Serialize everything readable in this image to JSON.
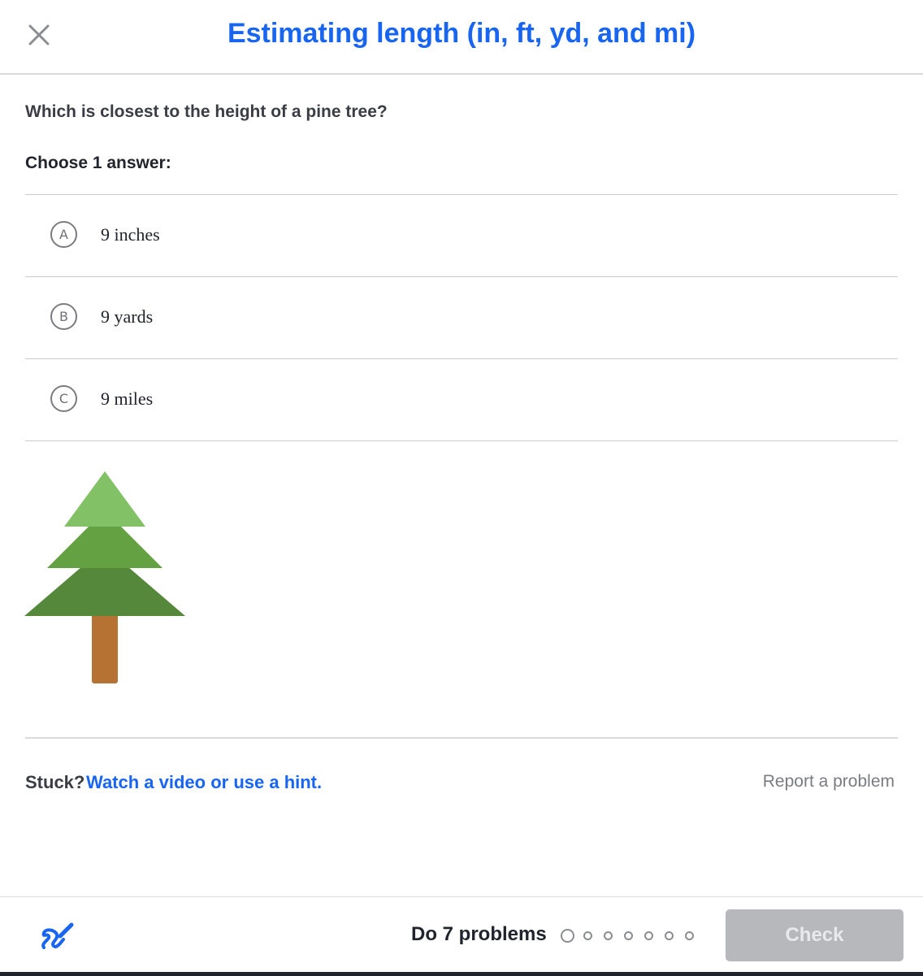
{
  "header": {
    "title": "Estimating length (in, ft, yd, and mi)",
    "close_icon": "close-icon"
  },
  "question": {
    "prompt": "Which is closest to the height of a pine tree?",
    "instruction": "Choose 1 answer:"
  },
  "choices": [
    {
      "letter": "A",
      "number": "9",
      "unit": "inches"
    },
    {
      "letter": "B",
      "number": "9",
      "unit": "yards"
    },
    {
      "letter": "C",
      "number": "9",
      "unit": "miles"
    }
  ],
  "illustration": {
    "icon": "pine-tree-icon",
    "colors": {
      "top": "#83c166",
      "middle": "#64a143",
      "bottom": "#55883b",
      "trunk": "#b57232"
    }
  },
  "help": {
    "stuck_label": "Stuck?",
    "hint_link": "Watch a video or use a hint.",
    "report_link": "Report a problem"
  },
  "footer": {
    "scratchpad_icon": "scratchpad-pencil-icon",
    "progress_label": "Do 7 problems",
    "problem_count": 7,
    "completed": 0,
    "check_label": "Check"
  },
  "colors": {
    "accent": "#1865f2",
    "text": "#21242c",
    "muted": "#7a7c81",
    "disabled_button": "#b7b8bb"
  }
}
